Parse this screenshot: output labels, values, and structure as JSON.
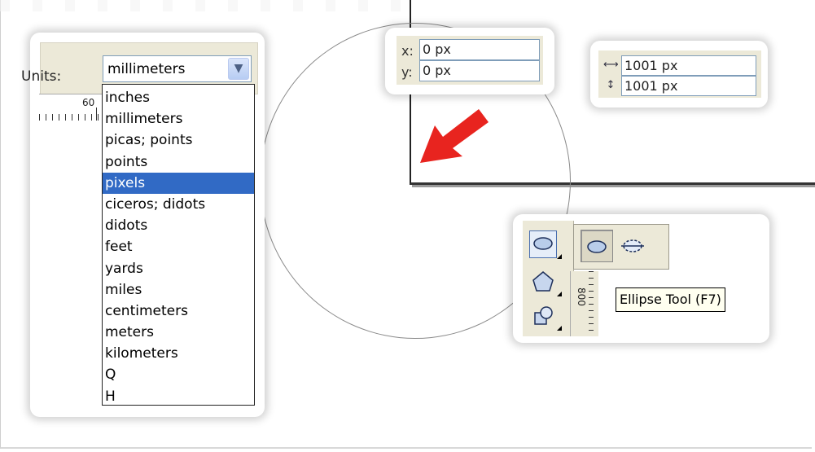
{
  "units_panel": {
    "label": "Units:",
    "selected_value": "millimeters",
    "ruler_number": "60",
    "options": [
      "inches",
      "millimeters",
      "picas; points",
      "points",
      "pixels",
      "ciceros; didots",
      "didots",
      "feet",
      "yards",
      "miles",
      "centimeters",
      "meters",
      "kilometers",
      "Q",
      "H"
    ],
    "highlighted_option": "pixels"
  },
  "position_panel": {
    "x_label": "x:",
    "x_value": "0 px",
    "y_label": "y:",
    "y_value": "0 px"
  },
  "size_panel": {
    "width_icon": "horizontal-size-icon",
    "width_value": "1001 px",
    "height_icon": "vertical-size-icon",
    "height_value": "1001 px"
  },
  "tool_panel": {
    "tools": [
      "ellipse-tool-icon",
      "polygon-tool-icon",
      "basic-shapes-tool-icon"
    ],
    "flyout": [
      "ellipse-icon",
      "three-point-ellipse-icon"
    ],
    "ruler_number": "800",
    "tooltip": "Ellipse Tool (F7)"
  },
  "colors": {
    "selection": "#316ac5",
    "arrow": "#e8241f",
    "toolbar": "#ece9d8"
  }
}
